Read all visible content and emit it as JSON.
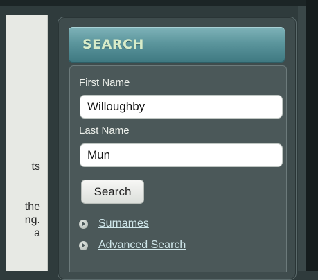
{
  "left_fragments": [
    "ts",
    "the",
    "ng.",
    "a"
  ],
  "search": {
    "title": "SEARCH",
    "first_name_label": "First Name",
    "first_name_value": "Willoughby",
    "last_name_label": "Last Name",
    "last_name_value": "Mun",
    "button_label": "Search"
  },
  "links": {
    "surnames": "Surnames",
    "advanced": "Advanced Search"
  },
  "colors": {
    "header_teal": "#5b959c",
    "panel_dark": "#4b5859",
    "link": "#cfe6ea"
  }
}
